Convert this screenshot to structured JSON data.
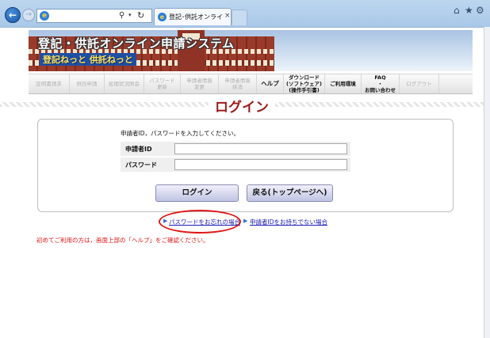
{
  "browser": {
    "tab_title": "登記･供託オンライン申請シス...",
    "tab_close": "×",
    "address_icon": "e",
    "back_glyph": "←",
    "forward_glyph": "→",
    "search_glyph": "⚲",
    "dropdown_glyph": "▾",
    "refresh_glyph": "↻",
    "home_glyph": "⌂",
    "star_glyph": "★",
    "gear_glyph": "⚙",
    "icons": [
      "back-icon",
      "forward-icon",
      "search-icon",
      "refresh-icon",
      "ie-icon",
      "home-icon",
      "star-icon",
      "gear-icon"
    ]
  },
  "banner": {
    "title": "登記・供託オンライン申請システム",
    "subtitle": "登記ねっと 供託ねっと"
  },
  "menu": [
    {
      "label": "証明書請求",
      "enabled": false
    },
    {
      "label": "供託申請",
      "enabled": false
    },
    {
      "label": "処理状況照会",
      "enabled": false
    },
    {
      "label": "パスワード\n更新",
      "enabled": false
    },
    {
      "label": "申請者情報\n変更",
      "enabled": false
    },
    {
      "label": "申請者情報\n抹消",
      "enabled": false
    },
    {
      "label": "ヘルプ",
      "enabled": true
    },
    {
      "label": "ダウンロード\n(ソフトウェア)\n(操作手引書)",
      "enabled": true
    },
    {
      "label": "ご利用環境",
      "enabled": true
    },
    {
      "label": "FAQ\n・\nお問い合わせ",
      "enabled": true
    },
    {
      "label": "ログアウト",
      "enabled": false
    }
  ],
  "page_title": "ログイン",
  "login": {
    "instruction": "申請者ID，パスワードを入力してください。",
    "id_label": "申請者ID",
    "id_value": "",
    "password_label": "パスワード",
    "password_value": "",
    "login_button": "ログイン",
    "back_button": "戻る(トップページへ)"
  },
  "links": {
    "arrow": "▶",
    "forgot_password": "パスワードをお忘れの場合",
    "no_id": "申請者IDをお持ちでない場合"
  },
  "notice": "初めてご利用の方は，画面上部の「ヘルプ」をご確認ください。",
  "colors": {
    "title_red": "#9b1b1b",
    "link_blue": "#1b1bb8",
    "notice_red": "#e01818",
    "highlight": "#e01818"
  }
}
